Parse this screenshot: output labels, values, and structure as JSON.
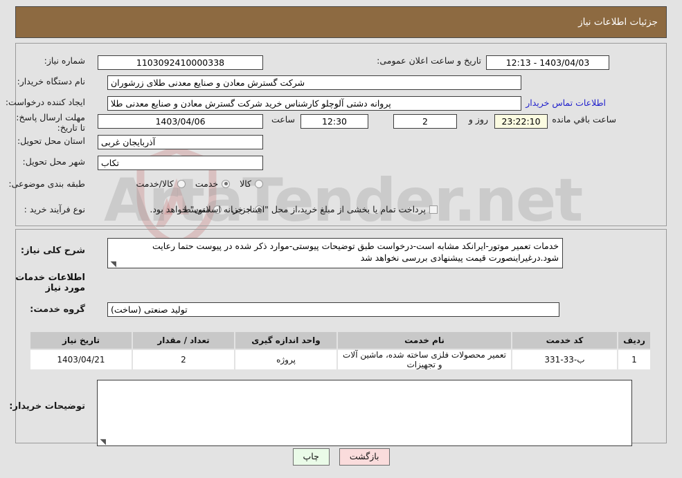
{
  "header": {
    "title": "جزئیات اطلاعات نیاز"
  },
  "colors": {
    "header_bg": "#8d6a41",
    "page_bg": "#e3e3e3",
    "link": "#2222cc",
    "back_button_bg": "#fadcdc",
    "print_button_bg": "#eafbe8",
    "table_header_bg": "#c8c8c8",
    "countdown_bg": "#fbfbe1"
  },
  "need_info": {
    "need_number_label": "شماره نیاز:",
    "need_number_value": "1103092410000338",
    "announce_datetime_label": "تاریخ و ساعت اعلان عمومی:",
    "announce_datetime_value": "1403/04/03 - 12:13",
    "buyer_org_label": "نام دستگاه خریدار:",
    "buyer_org_value": "شرکت گسترش معادن و صنایع معدنی طلای زرشوران",
    "requester_label": "ایجاد کننده درخواست:",
    "requester_value": "پروانه  دشتی آلوچلو کارشناس خرید شرکت گسترش معادن و صنایع معدنی طلا",
    "buyer_contact_link": "اطلاعات تماس خریدار",
    "deadline_label": "مهلت ارسال پاسخ: تا تاریخ:",
    "deadline_date": "1403/04/06",
    "deadline_hour_label": "ساعت",
    "deadline_hour": "12:30",
    "remaining_days": "2",
    "remaining_days_label": "روز و",
    "remaining_time": "23:22:10",
    "remaining_time_label": "ساعت باقي مانده",
    "province_label": "استان محل تحویل:",
    "province_value": "آذربایجان غربی",
    "city_label": "شهر محل تحویل:",
    "city_value": "تکاب",
    "category_label": "طبقه بندی موضوعی:",
    "category_options": [
      {
        "label": "کالا",
        "selected": false
      },
      {
        "label": "خدمت",
        "selected": true
      },
      {
        "label": "کالا/خدمت",
        "selected": false
      }
    ],
    "purchase_type_label": "نوع فرآیند خرید :",
    "purchase_type_options": [
      {
        "label": "جزیی",
        "selected": true
      },
      {
        "label": "متوسط",
        "selected": false
      }
    ],
    "treasury_checkbox_label": "پرداخت تمام یا بخشی از مبلغ خرید،از محل \"اسناد خزانه اسلامی\" خواهد بود.",
    "treasury_checked": false
  },
  "description": {
    "label": "شرح کلی نیاز:",
    "value": "خدمات تعمیر موتور-ایرانکد مشابه است-درخواست طبق توضیحات پیوستی-موارد ذکر شده در پیوست حتما رعایت شود.درغیراینصورت قیمت پیشنهادی بررسی نخواهد شد"
  },
  "services_section": {
    "heading": "اطلاعات خدمات مورد نیاز",
    "group_label": "گروه خدمت:",
    "group_value": "تولید صنعتی (ساخت)",
    "columns": [
      "ردیف",
      "کد خدمت",
      "نام خدمت",
      "واحد اندازه گیری",
      "تعداد / مقدار",
      "تاریخ نیاز"
    ],
    "rows": [
      {
        "index": "1",
        "code": "ب-33-331",
        "name": "تعمیر محصولات فلزی ساخته شده، ماشین آلات و تجهیزات",
        "unit": "پروژه",
        "quantity": "2",
        "date": "1403/04/21"
      }
    ]
  },
  "buyer_comments": {
    "label": "توضیحات خریدار:",
    "value": ""
  },
  "footer": {
    "print_label": "چاپ",
    "back_label": "بازگشت"
  },
  "watermark": {
    "text": "ArtaTender.net"
  }
}
